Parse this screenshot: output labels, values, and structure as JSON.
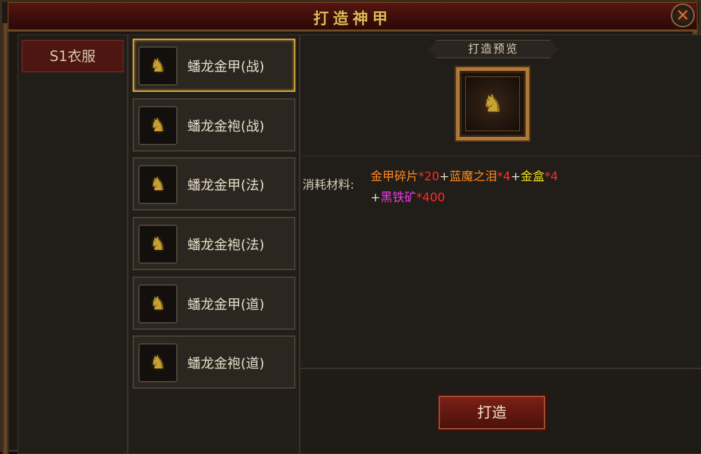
{
  "window": {
    "title": "打造神甲",
    "close_glyph": "✕"
  },
  "sidebar": {
    "category": "S1衣服"
  },
  "items": [
    {
      "label": "蟠龙金甲(战)",
      "icon": "armor-icon",
      "selected": true
    },
    {
      "label": "蟠龙金袍(战)",
      "icon": "robe-icon",
      "selected": false
    },
    {
      "label": "蟠龙金甲(法)",
      "icon": "armor-icon",
      "selected": false
    },
    {
      "label": "蟠龙金袍(法)",
      "icon": "robe-icon",
      "selected": false
    },
    {
      "label": "蟠龙金甲(道)",
      "icon": "armor-icon",
      "selected": false
    },
    {
      "label": "蟠龙金袍(道)",
      "icon": "robe-icon",
      "selected": false
    }
  ],
  "preview": {
    "label": "打造预览",
    "icon": "armor-icon"
  },
  "materials": {
    "label": "消耗材料:",
    "line1": [
      {
        "name": "金甲碎片",
        "qty": "*20"
      },
      {
        "name": "蓝魔之泪",
        "qty": "*4"
      },
      {
        "name": "金盒",
        "qty": "*4"
      }
    ],
    "line2": [
      {
        "name": "黑铁矿",
        "qty": "*400"
      }
    ],
    "plus": "+"
  },
  "actions": {
    "forge_label": "打造"
  },
  "colors": {
    "title": "#e4b85c",
    "selected_border": "#d0a640",
    "material_orange": "#ff8a20",
    "material_yellow": "#f4e21a",
    "material_purple": "#ee3ae8",
    "quantity_red": "#ff2a2a"
  }
}
